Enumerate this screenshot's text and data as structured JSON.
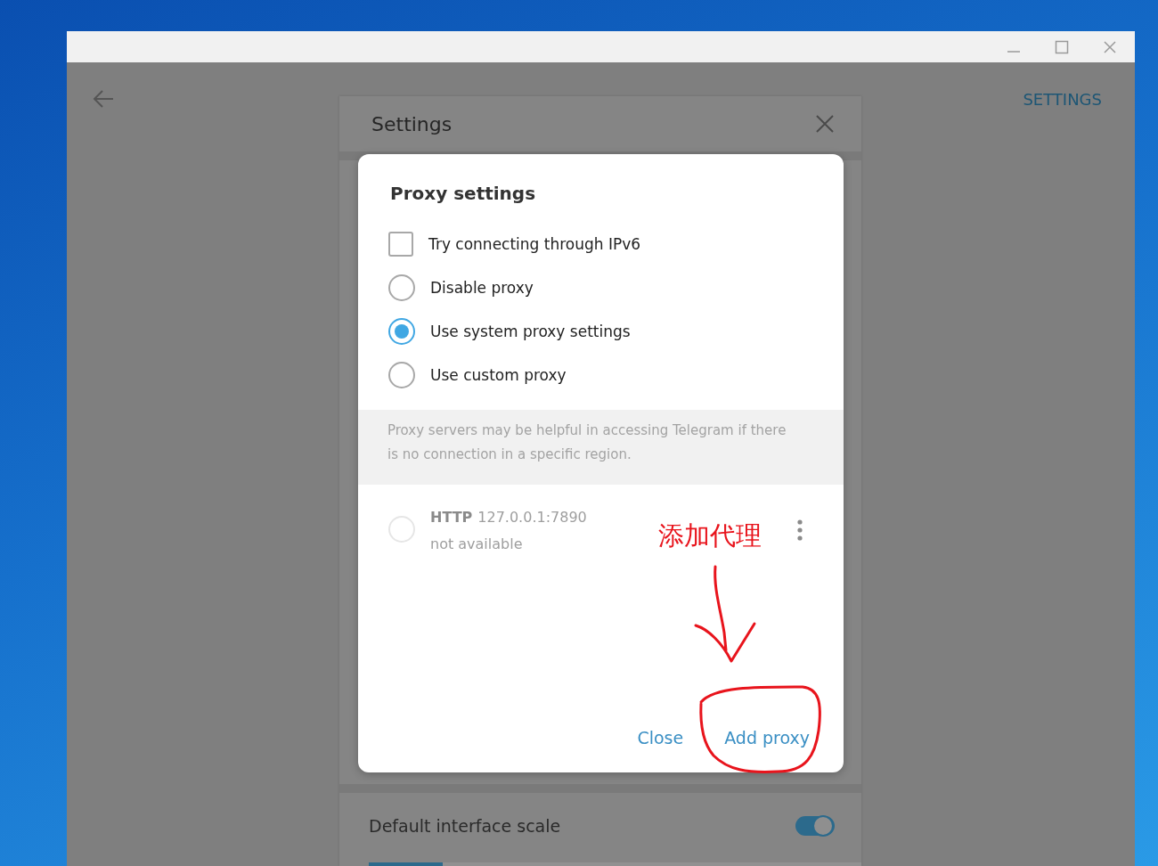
{
  "header": {
    "settings_link": "SETTINGS"
  },
  "settings_panel": {
    "title": "Settings",
    "rows": [
      {
        "label": "Default interface scale",
        "on": true
      }
    ],
    "scale_slider": {
      "level": 0.15
    }
  },
  "proxy_dialog": {
    "title": "Proxy settings",
    "options": [
      {
        "kind": "checkbox",
        "label": "Try connecting through IPv6",
        "checked": false
      },
      {
        "kind": "radio",
        "label": "Disable proxy",
        "selected": false
      },
      {
        "kind": "radio",
        "label": "Use system proxy settings",
        "selected": true
      },
      {
        "kind": "radio",
        "label": "Use custom proxy",
        "selected": false
      }
    ],
    "info": "Proxy servers may be helpful in accessing Telegram if there is no connection in a specific region.",
    "proxies": [
      {
        "type": "HTTP",
        "address": "127.0.0.1:7890",
        "status": "not available",
        "selected": false,
        "available": false
      }
    ],
    "buttons": [
      "Close",
      "Add proxy"
    ]
  },
  "annotation": {
    "text": "添加代理"
  }
}
